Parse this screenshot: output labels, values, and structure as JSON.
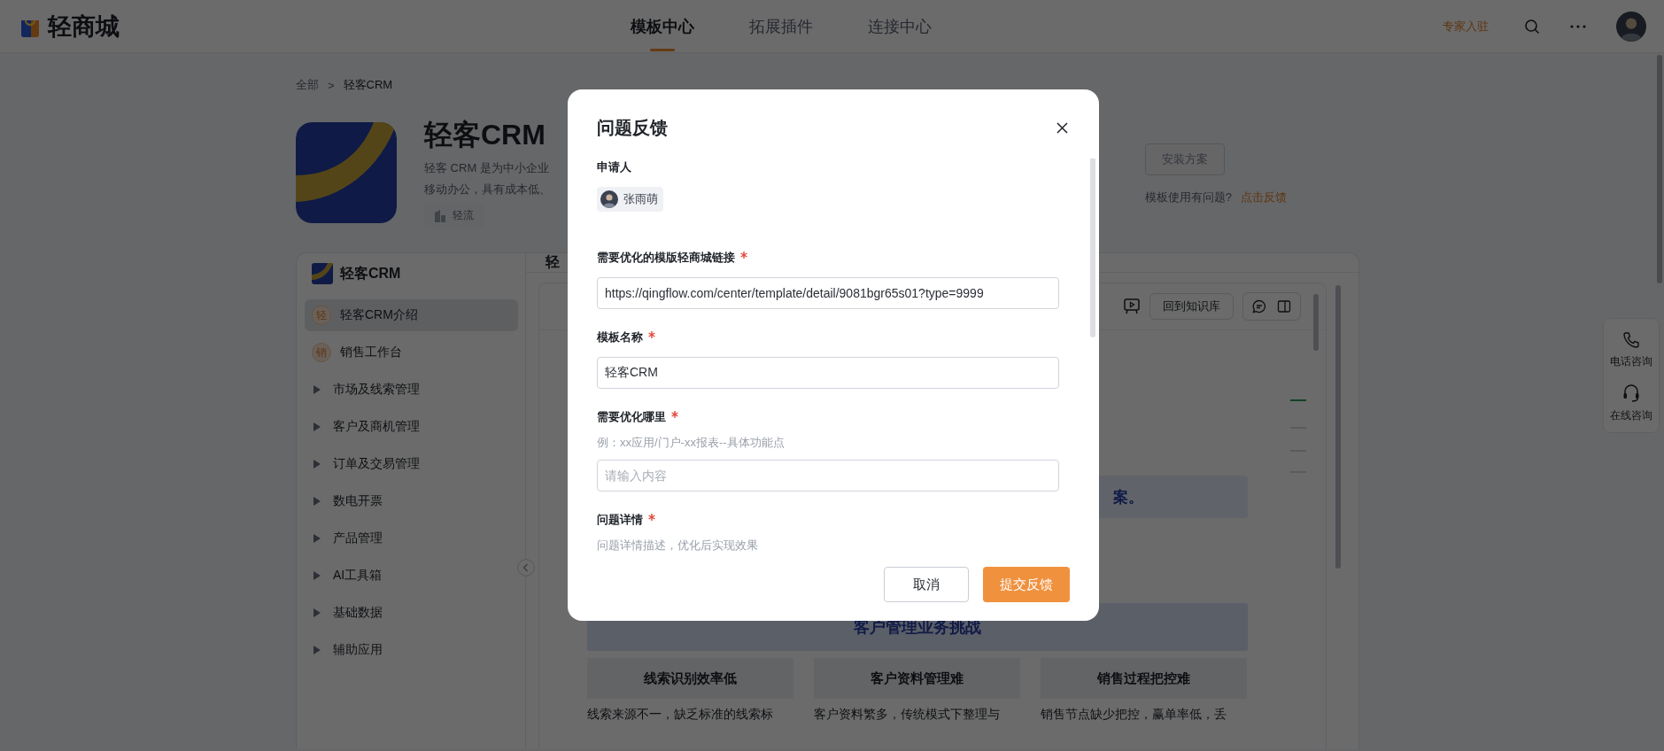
{
  "top_bar": {
    "logo": "轻商城",
    "tabs": [
      {
        "label": "模板中心",
        "selected": true
      },
      {
        "label": "拓展插件",
        "selected": false
      },
      {
        "label": "连接中心",
        "selected": false
      }
    ],
    "expert_link": "专家入驻"
  },
  "breadcrumb": [
    "全部",
    ">",
    "轻客CRM"
  ],
  "app": {
    "title": "轻客CRM",
    "description_lines": [
      "轻客 CRM 是为中小企业",
      "移动办公，具有成本低、"
    ],
    "tag": "轻流",
    "install_button": "安装方案",
    "feedback_hint": "模板使用有问题?",
    "feedback_link": "点击反馈"
  },
  "sidebar": {
    "title": "轻客CRM",
    "items": [
      {
        "kind": "page",
        "badge": "轻",
        "label": "轻客CRM介绍",
        "selected": true
      },
      {
        "kind": "page",
        "badge": "销",
        "label": "销售工作台",
        "selected": false
      },
      {
        "kind": "folder",
        "label": "市场及线索管理",
        "expanded": false
      },
      {
        "kind": "folder",
        "label": "客户及商机管理",
        "expanded": false
      },
      {
        "kind": "folder",
        "label": "订单及交易管理",
        "expanded": false
      },
      {
        "kind": "folder",
        "label": "数电开票",
        "expanded": false
      },
      {
        "kind": "folder",
        "label": "产品管理",
        "expanded": false
      },
      {
        "kind": "folder",
        "label": "AI工具箱",
        "expanded": false
      },
      {
        "kind": "folder",
        "label": "基础数据",
        "expanded": false
      },
      {
        "kind": "folder",
        "label": "辅助应用",
        "expanded": false
      }
    ]
  },
  "content": {
    "title": "轻",
    "back_button": "回到知识库",
    "banner_tail": "案。",
    "section_title": "客户管理业务挑战",
    "challenges": [
      {
        "title": "线索识别效率低",
        "text": "线索来源不一，缺乏标准的线索标"
      },
      {
        "title": "客户资料管理难",
        "text": "客户资料繁多，传统模式下整理与"
      },
      {
        "title": "销售过程把控难",
        "text": "销售节点缺少把控，赢单率低，丢"
      }
    ]
  },
  "float_panel": [
    {
      "kind": "phone",
      "label": "电话咨询"
    },
    {
      "kind": "headset",
      "label": "在线咨询"
    }
  ],
  "modal": {
    "title": "问题反馈",
    "fields": [
      {
        "kind": "applicant",
        "label": "申请人",
        "required": false,
        "user": "张雨萌"
      },
      {
        "kind": "input",
        "label": "需要优化的模版轻商城链接",
        "required": true,
        "value": "https://qingflow.com/center/template/detail/9081bgr65s01?type=9999"
      },
      {
        "kind": "input",
        "label": "模板名称",
        "required": true,
        "value": "轻客CRM"
      },
      {
        "kind": "input",
        "label": "需要优化哪里",
        "required": true,
        "hint": "例：xx应用/门户-xx报表--具体功能点",
        "placeholder": "请输入内容"
      },
      {
        "kind": "note",
        "label": "问题详情",
        "required": true,
        "hint": "问题详情描述，优化后实现效果"
      }
    ],
    "cancel_button": "取消",
    "submit_button": "提交反馈"
  }
}
